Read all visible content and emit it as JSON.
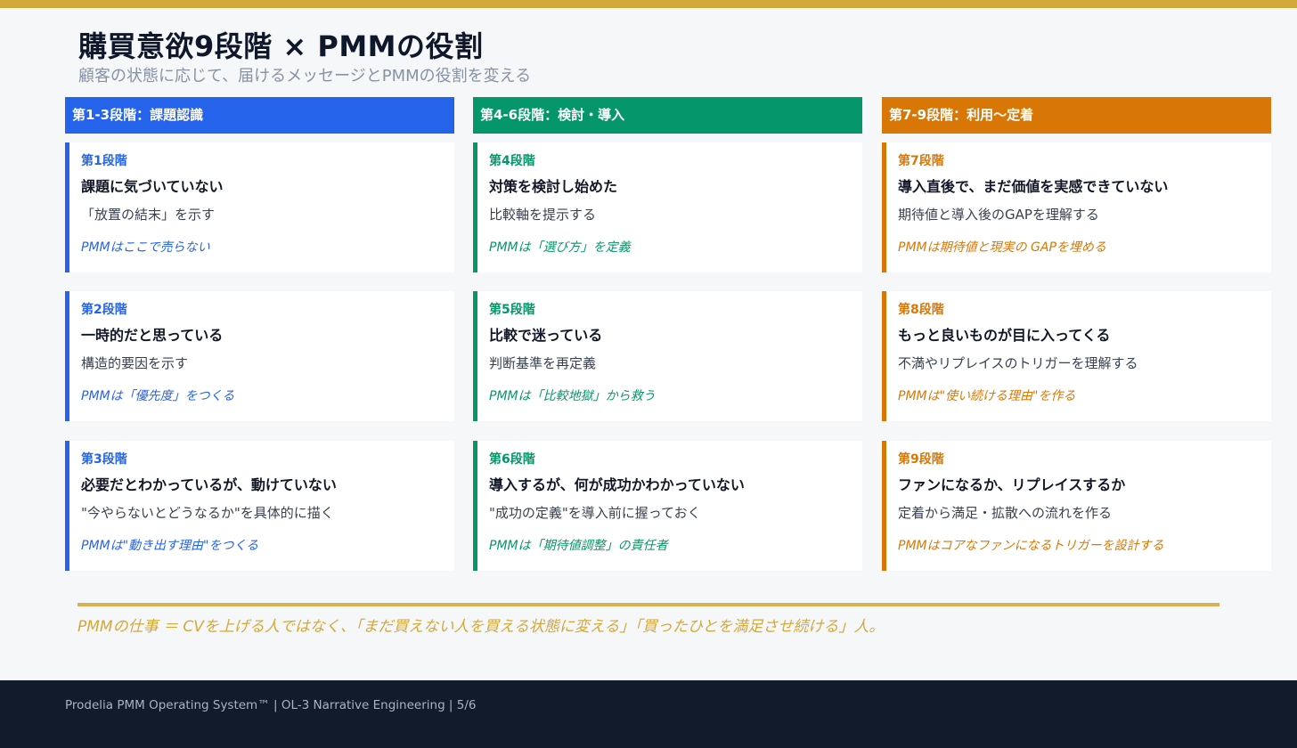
{
  "title": "購買意欲9段階 × PMMの役割",
  "subtitle": "顧客の状態に応じて、届けるメッセージとPMMの役割を変える",
  "colors": {
    "accent_gold": "#d4a838",
    "blue": "#2563eb",
    "green": "#059669",
    "orange": "#d97706",
    "footer_bg": "#111b2b"
  },
  "columns": [
    {
      "header": "第1-3段階：課題認識",
      "color": "#2563eb",
      "stages": [
        {
          "stage": "第1段階",
          "state": "課題に気づいていない",
          "message": "「放置の結末」を示す",
          "role": "PMMはここで売らない"
        },
        {
          "stage": "第2段階",
          "state": "一時的だと思っている",
          "message": "構造的要因を示す",
          "role": "PMMは「優先度」をつくる"
        },
        {
          "stage": "第3段階",
          "state": "必要だとわかっているが、動けていない",
          "message": "\"今やらないとどうなるか\"を具体的に描く",
          "role": "PMMは\"動き出す理由\"をつくる"
        }
      ]
    },
    {
      "header": "第4-6段階：検討・導入",
      "color": "#059669",
      "stages": [
        {
          "stage": "第4段階",
          "state": "対策を検討し始めた",
          "message": "比較軸を提示する",
          "role": "PMMは「選び方」を定義"
        },
        {
          "stage": "第5段階",
          "state": "比較で迷っている",
          "message": "判断基準を再定義",
          "role": "PMMは「比較地獄」から救う"
        },
        {
          "stage": "第6段階",
          "state": "導入するが、何が成功かわかっていない",
          "message": "\"成功の定義\"を導入前に握っておく",
          "role": "PMMは「期待値調整」の責任者"
        }
      ]
    },
    {
      "header": "第7-9段階：利用〜定着",
      "color": "#d97706",
      "stages": [
        {
          "stage": "第7段階",
          "state": "導入直後で、まだ価値を実感できていない",
          "message": "期待値と導入後のGAPを理解する",
          "role": "PMMは期待値と現実の GAPを埋める"
        },
        {
          "stage": "第8段階",
          "state": "もっと良いものが目に入ってくる",
          "message": "不満やリプレイスのトリガーを理解する",
          "role": "PMMは\"使い続ける理由\"を作る"
        },
        {
          "stage": "第9段階",
          "state": "ファンになるか、リプレイスするか",
          "message": "定着から満足・拡散への流れを作る",
          "role": "PMMはコアなファンになるトリガーを設計する"
        }
      ]
    }
  ],
  "conclusion": "PMMの仕事 ＝ CVを上げる人ではなく、「まだ買えない人を買える状態に変える」「買ったひとを満足させ続ける」人。",
  "footer": "Prodelia PMM Operating System™  |  OL-3 Narrative Engineering  |  5/6"
}
